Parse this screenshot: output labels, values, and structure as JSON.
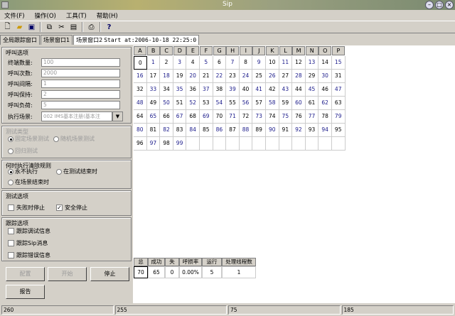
{
  "window": {
    "title": "Sip"
  },
  "menu": [
    "文件(F)",
    "操作(O)",
    "工具(T)",
    "帮助(H)"
  ],
  "tabs": [
    "全局跟踪窗口",
    "场景窗口1",
    "场景窗口2"
  ],
  "tab_status": "Start at:2006-10-18 22:25:0",
  "call_options": {
    "title": "呼叫选项",
    "fields": [
      {
        "label": "终端数量:",
        "value": "100"
      },
      {
        "label": "呼叫次数:",
        "value": "2000"
      },
      {
        "label": "呼叫间隔:",
        "value": "1"
      },
      {
        "label": "呼叫保持:",
        "value": "2"
      },
      {
        "label": "呼叫负荷:",
        "value": "5"
      }
    ],
    "scene_label": "执行场景:",
    "scene_value": "002 IMS基本注册(基本注"
  },
  "test_type": {
    "title": "测试类型",
    "options": [
      "固定场景测试",
      "随机场景测试",
      "回归测试"
    ]
  },
  "clear_rule": {
    "title": "何时执行清除规则",
    "options": [
      "永不执行",
      "在测试结束时",
      "在场景结束时"
    ]
  },
  "test_options": {
    "title": "测试选项",
    "options": [
      "失败时停止",
      "安全停止"
    ]
  },
  "trace_options": {
    "title": "跟踪选项",
    "options": [
      "跟踪调试信息",
      "跟踪Sip消息",
      "跟踪错误信息"
    ]
  },
  "buttons": {
    "config": "配置",
    "start": "开始",
    "stop": "停止",
    "report": "报告"
  },
  "grid": {
    "columns": [
      "A",
      "B",
      "C",
      "D",
      "E",
      "F",
      "G",
      "H",
      "I",
      "J",
      "K",
      "L",
      "M",
      "N",
      "O",
      "P"
    ],
    "rows": [
      [
        "0",
        "1",
        "2",
        "3",
        "4",
        "5",
        "6",
        "7",
        "8",
        "9",
        "10",
        "11",
        "12",
        "13",
        "14",
        "15"
      ],
      [
        "16",
        "17",
        "18",
        "19",
        "20",
        "21",
        "22",
        "23",
        "24",
        "25",
        "26",
        "27",
        "28",
        "29",
        "30",
        "31"
      ],
      [
        "32",
        "33",
        "34",
        "35",
        "36",
        "37",
        "38",
        "39",
        "40",
        "41",
        "42",
        "43",
        "44",
        "45",
        "46",
        "47"
      ],
      [
        "48",
        "49",
        "50",
        "51",
        "52",
        "53",
        "54",
        "55",
        "56",
        "57",
        "58",
        "59",
        "60",
        "61",
        "62",
        "63"
      ],
      [
        "64",
        "65",
        "66",
        "67",
        "68",
        "69",
        "70",
        "71",
        "72",
        "73",
        "74",
        "75",
        "76",
        "77",
        "78",
        "79"
      ],
      [
        "80",
        "81",
        "82",
        "83",
        "84",
        "85",
        "86",
        "87",
        "88",
        "89",
        "90",
        "91",
        "92",
        "93",
        "94",
        "95"
      ],
      [
        "96",
        "97",
        "98",
        "99",
        "",
        "",
        "",
        "",
        "",
        "",
        "",
        "",
        "",
        "",
        "",
        ""
      ]
    ]
  },
  "stats": {
    "headers": [
      "总共",
      "成功",
      "失败",
      "呼损率",
      "运行中",
      "处理线程数"
    ],
    "values": [
      "70",
      "65",
      "0",
      "0.00%",
      "5",
      "1"
    ]
  },
  "statusbar": [
    "260",
    "255",
    "75",
    "185"
  ]
}
